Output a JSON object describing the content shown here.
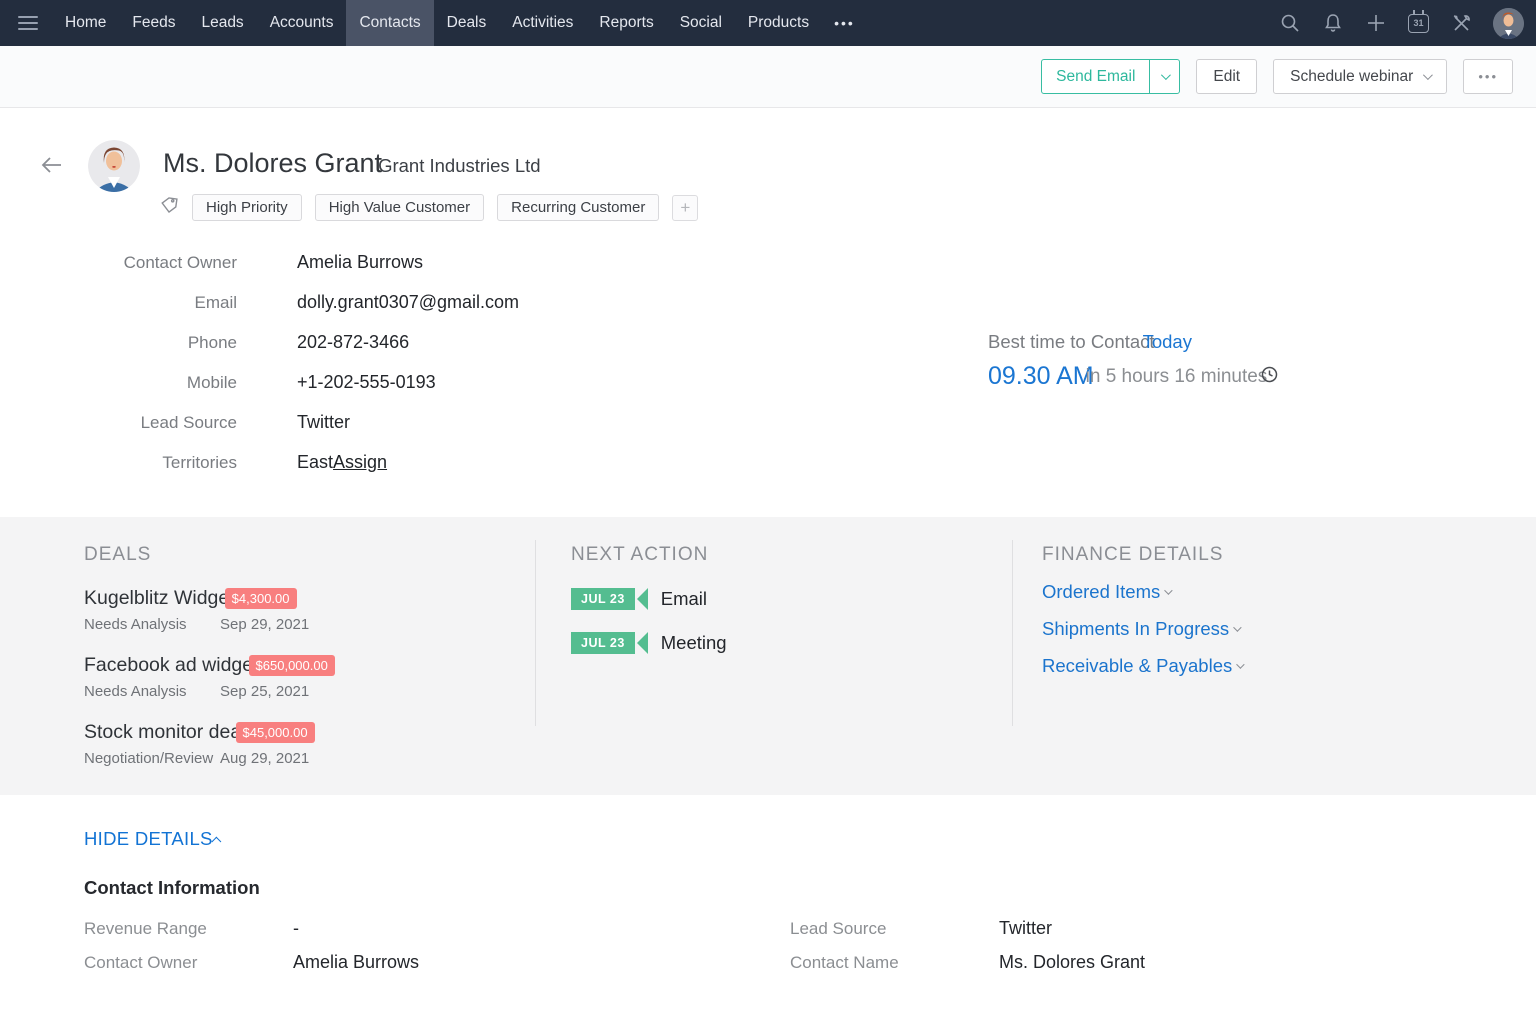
{
  "nav": {
    "items": [
      "Home",
      "Feeds",
      "Leads",
      "Accounts",
      "Contacts",
      "Deals",
      "Activities",
      "Reports",
      "Social",
      "Products"
    ],
    "active_item": "Contacts",
    "more_label": "•••",
    "calendar_day": "31"
  },
  "action_bar": {
    "send_email_label": "Send Email",
    "edit_label": "Edit",
    "schedule_webinar_label": "Schedule webinar",
    "more_label": "•••"
  },
  "header": {
    "name": "Ms. Dolores Grant",
    "company": "Grant Industries Ltd",
    "tags": [
      "High Priority",
      "High Value Customer",
      "Recurring Customer"
    ],
    "add_tag_label": "+"
  },
  "details": {
    "fields": [
      {
        "label": "Contact Owner",
        "value": "Amelia Burrows"
      },
      {
        "label": "Email",
        "value": "dolly.grant0307@gmail.com"
      },
      {
        "label": "Phone",
        "value": "202-872-3466"
      },
      {
        "label": "Mobile",
        "value": "+1-202-555-0193"
      },
      {
        "label": "Lead Source",
        "value": "Twitter"
      },
      {
        "label": "Territories",
        "value": "East",
        "link": "Assign"
      }
    ]
  },
  "best_time": {
    "label": "Best time to Contact",
    "day": "Today",
    "time": "09.30 AM",
    "relative": "in 5 hours 16 minutes"
  },
  "deals": {
    "title": "DEALS",
    "items": [
      {
        "name": "Kugelblitz Widget",
        "amount": "$4,300.00",
        "stage": "Needs Analysis",
        "date": "Sep 29, 2021"
      },
      {
        "name": "Facebook ad widget",
        "amount": "$650,000.00",
        "stage": "Needs Analysis",
        "date": "Sep 25, 2021"
      },
      {
        "name": "Stock monitor deal",
        "amount": "$45,000.00",
        "stage": "Negotiation/Review",
        "date": "Aug 29, 2021"
      }
    ]
  },
  "next_action": {
    "title": "NEXT ACTION",
    "items": [
      {
        "date": "JUL 23",
        "action": "Email"
      },
      {
        "date": "JUL 23",
        "action": "Meeting"
      }
    ]
  },
  "finance": {
    "title": "FINANCE DETAILS",
    "links": [
      "Ordered Items",
      "Shipments In Progress",
      "Receivable & Payables"
    ]
  },
  "bottom": {
    "hide_details_label": "HIDE DETAILS",
    "heading": "Contact Information",
    "left_fields": [
      {
        "label": "Revenue Range",
        "value": "-"
      },
      {
        "label": "Contact Owner",
        "value": "Amelia Burrows"
      }
    ],
    "right_fields": [
      {
        "label": "Lead Source",
        "value": "Twitter"
      },
      {
        "label": "Contact Name",
        "value": "Ms. Dolores Grant"
      }
    ]
  },
  "colors": {
    "navbar_bg": "#232d3e",
    "accent_teal": "#2eb89d",
    "link_blue": "#1b74cd",
    "amount_badge_red": "#f87f7f",
    "next_action_green": "#54bd90"
  }
}
